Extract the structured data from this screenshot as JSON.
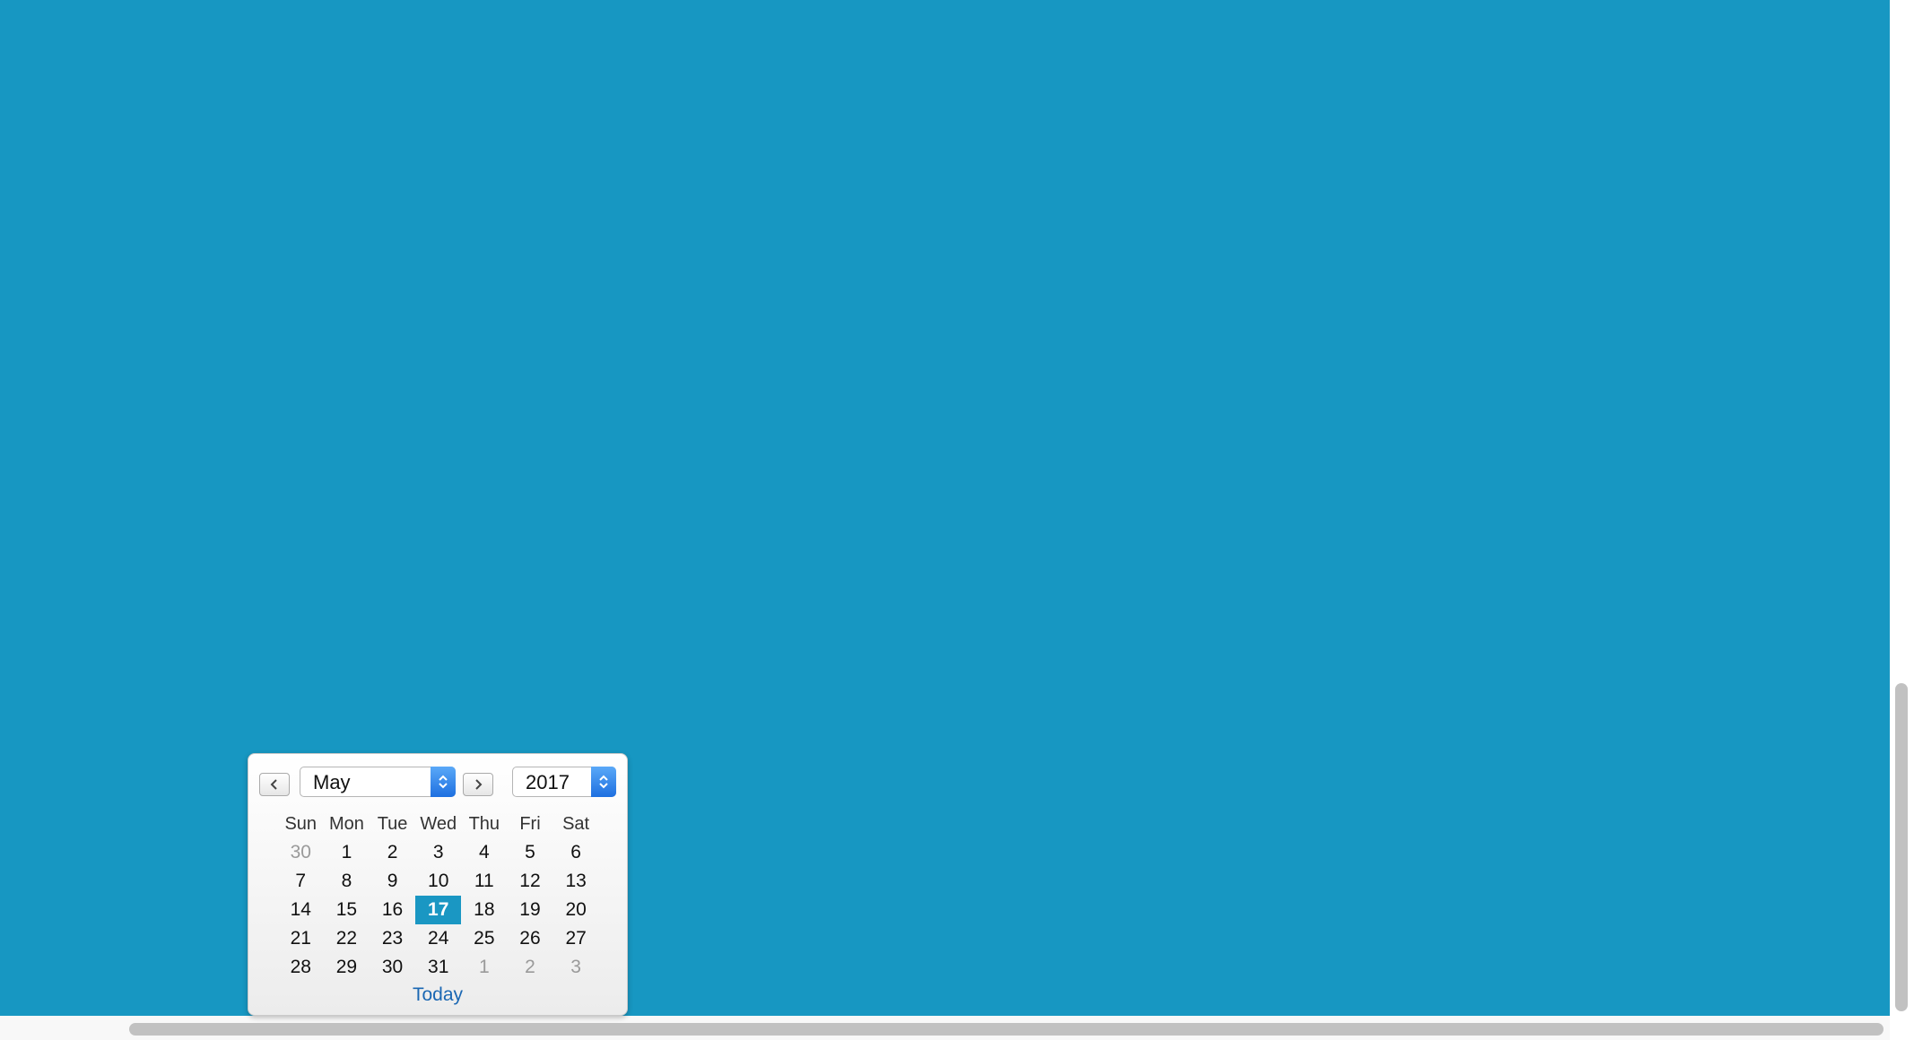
{
  "datepicker": {
    "month": "May",
    "year": "2017",
    "today_label": "Today",
    "weekdays": [
      "Sun",
      "Mon",
      "Tue",
      "Wed",
      "Thu",
      "Fri",
      "Sat"
    ],
    "weeks": [
      [
        {
          "d": "30",
          "other": true
        },
        {
          "d": "1"
        },
        {
          "d": "2"
        },
        {
          "d": "3"
        },
        {
          "d": "4"
        },
        {
          "d": "5"
        },
        {
          "d": "6"
        }
      ],
      [
        {
          "d": "7"
        },
        {
          "d": "8"
        },
        {
          "d": "9"
        },
        {
          "d": "10"
        },
        {
          "d": "11"
        },
        {
          "d": "12"
        },
        {
          "d": "13"
        }
      ],
      [
        {
          "d": "14"
        },
        {
          "d": "15"
        },
        {
          "d": "16"
        },
        {
          "d": "17",
          "selected": true
        },
        {
          "d": "18"
        },
        {
          "d": "19"
        },
        {
          "d": "20"
        }
      ],
      [
        {
          "d": "21"
        },
        {
          "d": "22"
        },
        {
          "d": "23"
        },
        {
          "d": "24"
        },
        {
          "d": "25"
        },
        {
          "d": "26"
        },
        {
          "d": "27"
        }
      ],
      [
        {
          "d": "28"
        },
        {
          "d": "29"
        },
        {
          "d": "30"
        },
        {
          "d": "31"
        },
        {
          "d": "1",
          "other": true
        },
        {
          "d": "2",
          "other": true
        },
        {
          "d": "3",
          "other": true
        }
      ]
    ],
    "icons": {
      "prev": "chevron-left-icon",
      "next": "chevron-right-icon",
      "select_arrow": "up-down-arrows-icon"
    }
  },
  "colors": {
    "page_background": "#1797c2",
    "selected_day": "#1a97c3",
    "today_link": "#1a67b3"
  }
}
